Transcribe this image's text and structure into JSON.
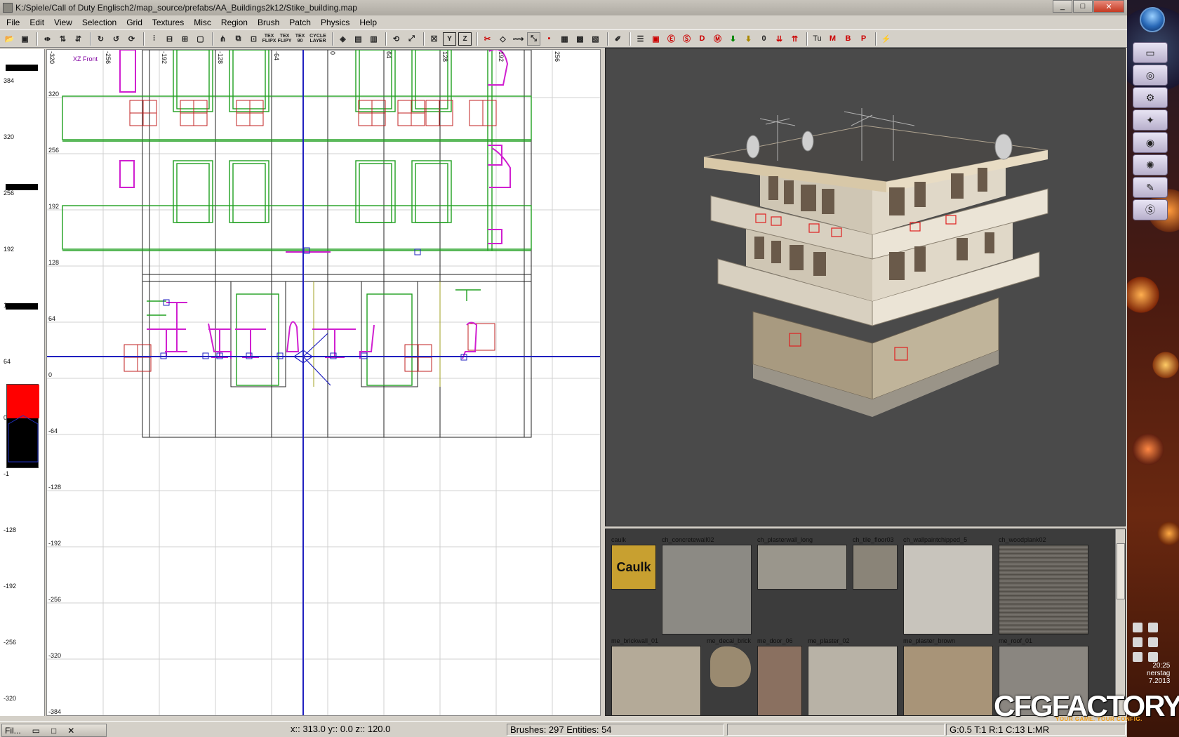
{
  "window": {
    "title": "K:/Spiele/Call of Duty Englisch2/map_source/prefabs/AA_Buildings2k12/Stike_building.map"
  },
  "menu": [
    "File",
    "Edit",
    "View",
    "Selection",
    "Grid",
    "Textures",
    "Misc",
    "Region",
    "Brush",
    "Patch",
    "Physics",
    "Help"
  ],
  "toolbar": {
    "tex_flip_x": "TEX FLIPX",
    "tex_flip_y": "TEX FLIPY",
    "tex_90": "TEX 90",
    "cycle_layer": "CYCLE LAYER",
    "y_btn": "Y",
    "z_btn": "Z",
    "letters": [
      "D",
      "M",
      "0",
      "Tu",
      "M",
      "B",
      "P"
    ]
  },
  "view2d": {
    "label": "XZ Front",
    "top_ticks": [
      "-320",
      "-256",
      "-192",
      "-128",
      "-64",
      "0",
      "64",
      "128",
      "192",
      "256"
    ],
    "left_ticks": [
      "320",
      "256",
      "192",
      "128",
      "64",
      "0",
      "-64",
      "-128",
      "-192",
      "-256",
      "-320",
      "-384"
    ]
  },
  "zruler": {
    "labels": [
      "384",
      "320",
      "256",
      "192",
      "1",
      "64",
      "0",
      "-1",
      "-128",
      "-192",
      "-256",
      "-320"
    ]
  },
  "textures": [
    {
      "name": "caulk",
      "label": "Caulk",
      "color": "#c8a030"
    },
    {
      "name": "ch_concretewall02",
      "color": "#8c8a84"
    },
    {
      "name": "ch_plasterwall_long",
      "color": "#9a968c"
    },
    {
      "name": "ch_tile_floor03",
      "color": "#8a8478"
    },
    {
      "name": "ch_wallpaintchipped_5",
      "color": "#c8c4bc"
    },
    {
      "name": "ch_woodplank02",
      "color": "#6a6660"
    },
    {
      "name": "me_brickwall_01",
      "color": "#b4aa98"
    },
    {
      "name": "me_decal_brick",
      "color": "#9a8a70"
    },
    {
      "name": "me_door_06",
      "color": "#8a7060"
    },
    {
      "name": "me_plaster_02",
      "color": "#b8b2a6"
    },
    {
      "name": "me_plaster_brown",
      "color": "#a89478"
    },
    {
      "name": "me_roof_01",
      "color": "#8a8680"
    }
  ],
  "status": {
    "taskbar_item": "Fil...",
    "coords": "x:: 313.0  y:: 0.0  z:: 120.0",
    "counts": "Brushes: 297 Entities: 54",
    "grid": "G:0.5 T:1 R:1 C:13 L:MR"
  },
  "tray": {
    "clock_lines": [
      "20:25",
      "nerstag",
      "7.2013"
    ]
  },
  "watermark": {
    "brand": "CFGFACTORY",
    "tagline": "YOUR GAME. YOUR CONFIG."
  }
}
